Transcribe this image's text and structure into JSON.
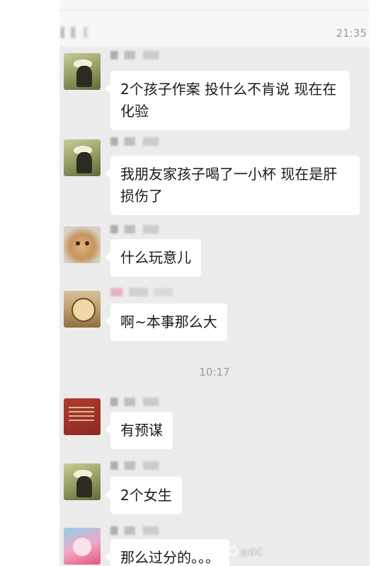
{
  "header": {
    "time": "21:35"
  },
  "messages": [
    {
      "text": "2个孩子作案  投什么不肯说 现在在化验",
      "avatar": "straw-hat-avatar"
    },
    {
      "text": "我朋友家孩子喝了一小杯 现在是肝损伤了",
      "avatar": "straw-hat-avatar"
    },
    {
      "text": "什么玩意儿",
      "avatar": "bear-avatar"
    },
    {
      "text": "啊~本事那么大",
      "avatar": "cat-avatar"
    },
    {
      "text": "有预谋",
      "avatar": "book-avatar"
    },
    {
      "text": "2个女生",
      "avatar": "straw-hat-avatar"
    },
    {
      "text": "那么过分的。。。",
      "avatar": "pink-cartoon-avatar"
    }
  ],
  "time_separator": "10:17",
  "watermark": "@律Č"
}
